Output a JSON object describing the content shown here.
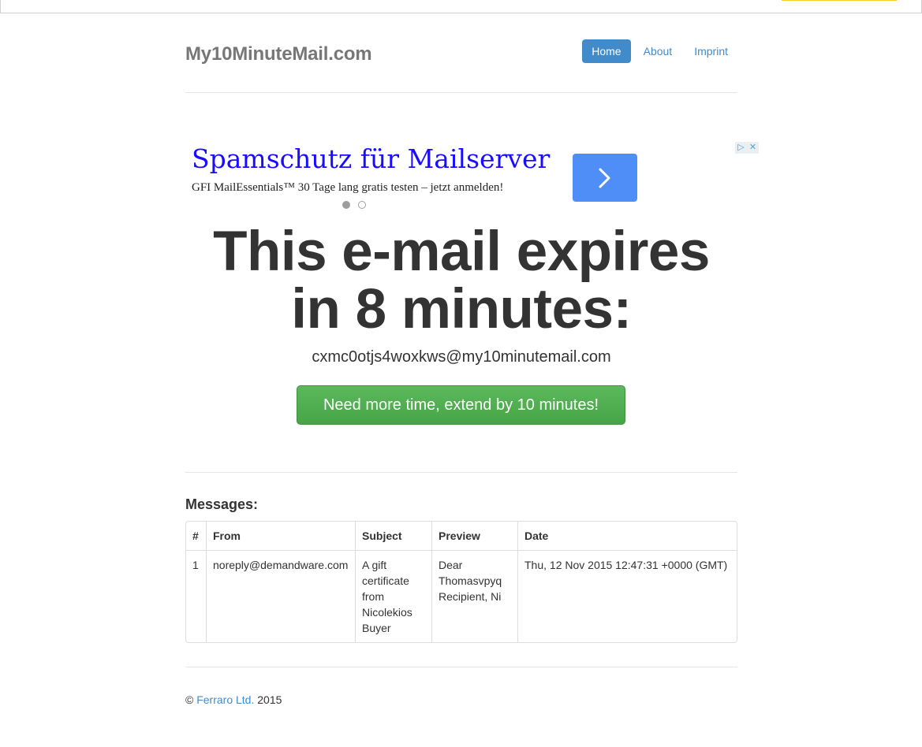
{
  "site": {
    "brand": "My10MinuteMail.com"
  },
  "nav": {
    "items": [
      {
        "label": "Home",
        "active": true
      },
      {
        "label": "About",
        "active": false
      },
      {
        "label": "Imprint",
        "active": false
      }
    ]
  },
  "ad": {
    "title": "Spamschutz für Mailserver",
    "description": "GFI MailEssentials™ 30 Tage lang gratis testen – jetzt anmelden!",
    "arrow_icon": "chevron-right-icon",
    "choices_icon": "adchoices-icon",
    "close_icon": "close-icon",
    "arrow_color": "#4f8ef7",
    "title_color": "#1a0dff"
  },
  "main": {
    "expires_text": "This e-mail expires in 8 minutes:",
    "email_address": "cxmc0otjs4woxkws@my10minutemail.com",
    "extend_button": "Need more time, extend by 10 minutes!"
  },
  "messages": {
    "title": "Messages:",
    "columns": [
      "#",
      "From",
      "Subject",
      "Preview",
      "Date"
    ],
    "rows": [
      {
        "num": "1",
        "from": "noreply@demandware.com",
        "subject": "A gift certificate from Nicolekios Buyer",
        "preview": "Dear Thomasvpyq Recipient, Ni",
        "date": "Thu, 12 Nov 2015 12:47:31 +0000 (GMT)"
      }
    ]
  },
  "footer": {
    "copyright": "©",
    "company": "Ferraro Ltd.",
    "year": "2015"
  },
  "colors": {
    "primary": "#428bca",
    "success": "#5cb85c"
  }
}
